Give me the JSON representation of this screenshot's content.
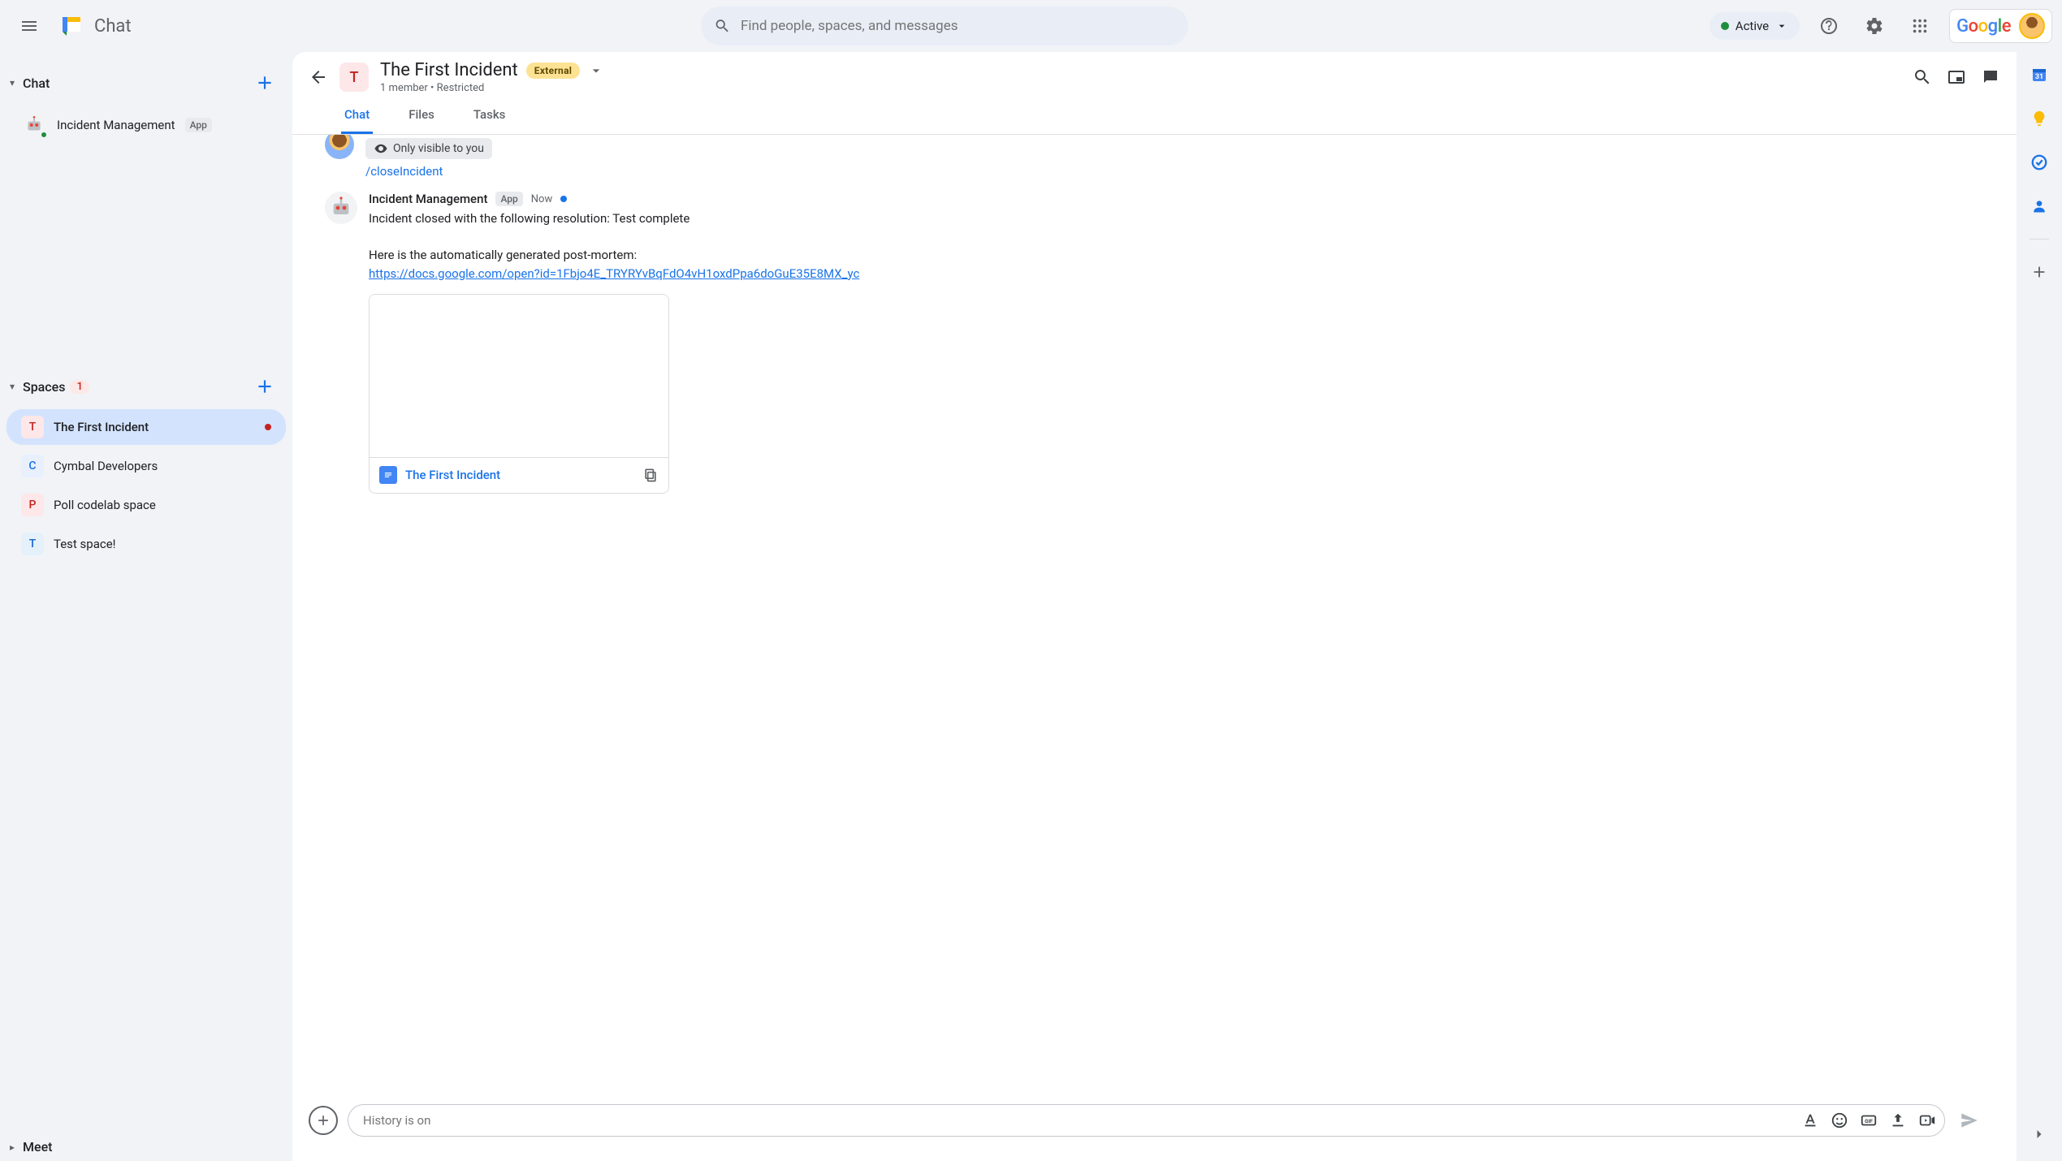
{
  "app": {
    "name": "Chat"
  },
  "search": {
    "placeholder": "Find people, spaces, and messages"
  },
  "status": {
    "label": "Active"
  },
  "sidebar": {
    "chat_section": "Chat",
    "chat_items": [
      {
        "name": "Incident Management",
        "app_pill": "App"
      }
    ],
    "spaces_section": "Spaces",
    "spaces_badge": "1",
    "spaces": [
      {
        "chip": "T",
        "name": "The First Incident",
        "class": "chip-pink",
        "active": true,
        "dot": true
      },
      {
        "chip": "C",
        "name": "Cymbal Developers",
        "class": "chip-blue"
      },
      {
        "chip": "P",
        "name": "Poll codelab space",
        "class": "chip-pink"
      },
      {
        "chip": "T",
        "name": "Test space!",
        "class": "chip-lblue"
      }
    ],
    "meet_section": "Meet"
  },
  "chat_header": {
    "chip": "T",
    "title": "The First Incident",
    "external": "External",
    "subtitle": "1 member  •  Restricted"
  },
  "tabs": {
    "chat": "Chat",
    "files": "Files",
    "tasks": "Tasks"
  },
  "messages": {
    "only_visible": "Only visible to you",
    "slash": "/closeIncident",
    "bot_name": "Incident Management",
    "app_pill": "App",
    "timestamp": "Now",
    "line1": "Incident closed with the following resolution: Test complete",
    "line2": "Here is the automatically generated post-mortem:",
    "link": "https://docs.google.com/open?id=1Fbjo4E_TRYRYvBqFdO4vH1oxdPpa6doGuE35E8MX_yc",
    "doc_name": "The First Incident"
  },
  "composer": {
    "placeholder": "History is on"
  },
  "google_word": "Google"
}
